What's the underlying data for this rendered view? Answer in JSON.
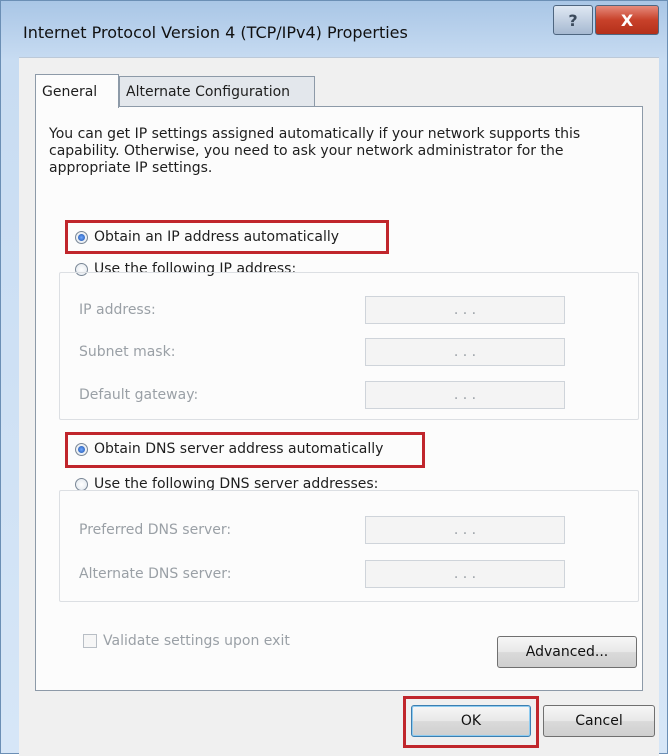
{
  "window": {
    "title": "Internet Protocol Version 4 (TCP/IPv4) Properties",
    "help_label": "?",
    "close_label": "X"
  },
  "tabs": [
    {
      "label": "General",
      "selected": true
    },
    {
      "label": "Alternate Configuration",
      "selected": false
    }
  ],
  "intro_text": "You can get IP settings assigned automatically if your network supports this capability. Otherwise, you need to ask your network administrator for the appropriate IP settings.",
  "ip_section": {
    "auto_label": "Obtain an IP address automatically",
    "auto_selected": true,
    "manual_label": "Use the following IP address:",
    "fields": [
      {
        "label": "IP address:",
        "value": ".   .   ."
      },
      {
        "label": "Subnet mask:",
        "value": ".   .   ."
      },
      {
        "label": "Default gateway:",
        "value": ".   .   ."
      }
    ]
  },
  "dns_section": {
    "auto_label": "Obtain DNS server address automatically",
    "auto_selected": true,
    "manual_label": "Use the following DNS server addresses:",
    "fields": [
      {
        "label": "Preferred DNS server:",
        "value": ".   .   ."
      },
      {
        "label": "Alternate DNS server:",
        "value": ".   .   ."
      }
    ]
  },
  "validate_label": "Validate settings upon exit",
  "buttons": {
    "advanced": "Advanced...",
    "ok": "OK",
    "cancel": "Cancel"
  },
  "colors": {
    "highlight": "#c0262c",
    "title_close": "#c8412a"
  }
}
